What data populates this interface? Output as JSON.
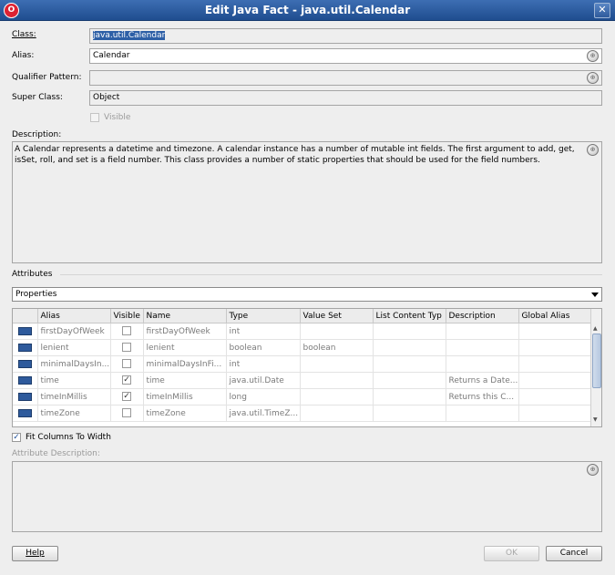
{
  "window": {
    "title": "Edit Java Fact - java.util.Calendar",
    "close_glyph": "✕",
    "app_glyph": "O"
  },
  "form": {
    "class_label": "Class:",
    "class_value": "java.util.Calendar",
    "alias_label": "Alias:",
    "alias_value": "Calendar",
    "qualifier_label": "Qualifier Pattern:",
    "qualifier_value": "",
    "superclass_label": "Super Class:",
    "superclass_value": "Object",
    "visible_label": "Visible",
    "description_label": "Description:",
    "description_text": "A Calendar represents a datetime and timezone. A calendar instance has a number of mutable int fields. The first argument to add, get, isSet, roll, and set is a field number. This class provides a number of static properties that should be used for the field numbers."
  },
  "attributes": {
    "section_label": "Attributes",
    "dropdown_value": "Properties",
    "columns": [
      "",
      "Alias",
      "Visible",
      "Name",
      "Type",
      "Value Set",
      "List Content Typ",
      "Description",
      "Global Alias"
    ],
    "rows": [
      {
        "alias": "firstDayOfWeek",
        "visible": false,
        "name": "firstDayOfWeek",
        "type": "int",
        "value_set": "",
        "list_type": "",
        "description": "",
        "global_alias": ""
      },
      {
        "alias": "lenient",
        "visible": false,
        "name": "lenient",
        "type": "boolean",
        "value_set": "boolean",
        "list_type": "",
        "description": "",
        "global_alias": ""
      },
      {
        "alias": "minimalDaysIn...",
        "visible": false,
        "name": "minimalDaysInFi...",
        "type": "int",
        "value_set": "",
        "list_type": "",
        "description": "",
        "global_alias": ""
      },
      {
        "alias": "time",
        "visible": true,
        "name": "time",
        "type": "java.util.Date",
        "value_set": "",
        "list_type": "",
        "description": "Returns a Date...",
        "global_alias": ""
      },
      {
        "alias": "timeInMillis",
        "visible": true,
        "name": "timeInMillis",
        "type": "long",
        "value_set": "",
        "list_type": "",
        "description": "Returns this C...",
        "global_alias": ""
      },
      {
        "alias": "timeZone",
        "visible": false,
        "name": "timeZone",
        "type": "java.util.TimeZ...",
        "value_set": "",
        "list_type": "",
        "description": "",
        "global_alias": ""
      }
    ],
    "fit_columns_label": "Fit Columns To Width",
    "fit_columns_checked": true,
    "attr_desc_label": "Attribute Description:"
  },
  "buttons": {
    "help": "Help",
    "ok": "OK",
    "cancel": "Cancel"
  },
  "icons": {
    "globe": "globe-icon",
    "row": "java-fact-property-icon"
  },
  "colors": {
    "title_bar": "#2a5a9c",
    "selection": "#2d5fa6"
  }
}
